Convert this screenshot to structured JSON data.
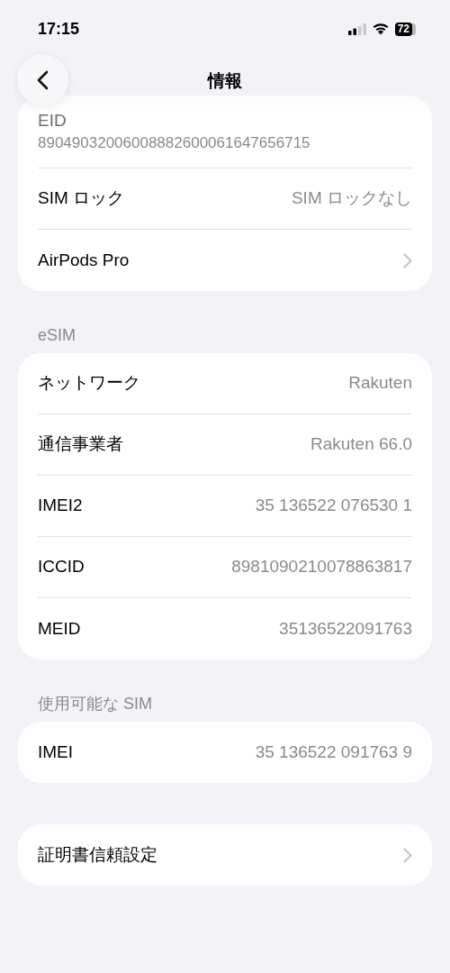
{
  "status_bar": {
    "time": "17:15",
    "battery": "72"
  },
  "nav": {
    "title": "情報"
  },
  "sections": [
    {
      "rows": [
        {
          "kind": "stacked",
          "label": "EID",
          "value": "89049032006008882600061647656715"
        },
        {
          "kind": "value",
          "label": "SIM ロック",
          "value": "SIM ロックなし"
        },
        {
          "kind": "link",
          "label": "AirPods Pro"
        }
      ]
    },
    {
      "header": "eSIM",
      "rows": [
        {
          "kind": "value",
          "label": "ネットワーク",
          "value": "Rakuten"
        },
        {
          "kind": "value",
          "label": "通信事業者",
          "value": "Rakuten 66.0"
        },
        {
          "kind": "value",
          "label": "IMEI2",
          "value": "35 136522 076530 1"
        },
        {
          "kind": "value",
          "label": "ICCID",
          "value": "8981090210078863817"
        },
        {
          "kind": "value",
          "label": "MEID",
          "value": "35136522091763"
        }
      ]
    },
    {
      "header": "使用可能な SIM",
      "rows": [
        {
          "kind": "value",
          "label": "IMEI",
          "value": "35 136522 091763 9"
        }
      ]
    },
    {
      "rows": [
        {
          "kind": "link",
          "label": "証明書信頼設定"
        }
      ]
    }
  ]
}
